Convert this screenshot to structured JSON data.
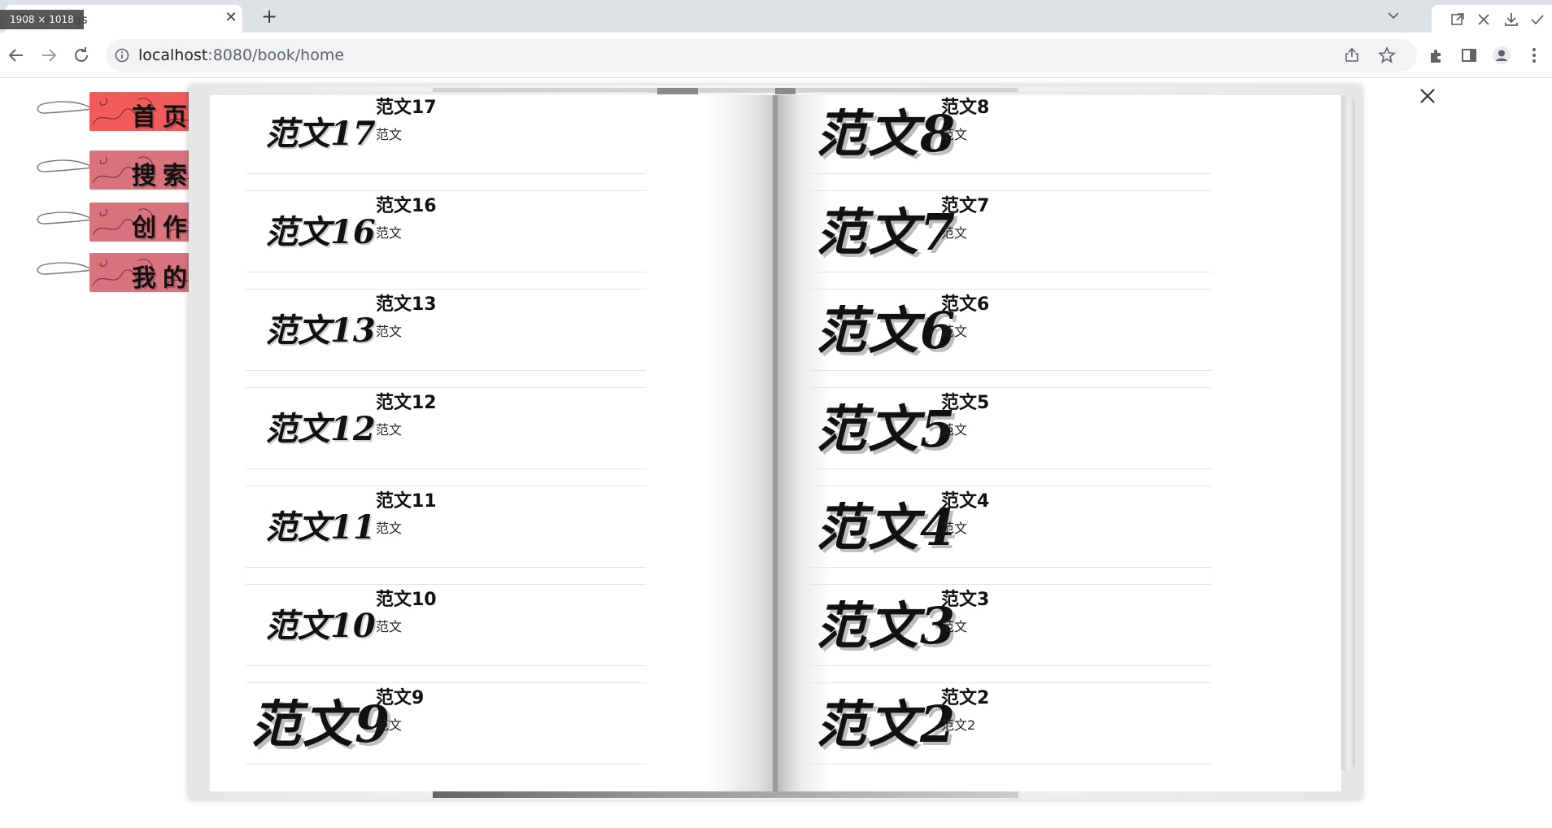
{
  "browser": {
    "tab_title": "ve-blogs",
    "dim_badge": "1908 × 1018",
    "url_host": "localhost",
    "url_rest": ":8080/book/home"
  },
  "side_tags": [
    {
      "label": "首页",
      "active": true
    },
    {
      "label": "搜索",
      "active": false
    },
    {
      "label": "创作",
      "active": false
    },
    {
      "label": "我的",
      "active": false
    }
  ],
  "left_page": [
    {
      "thumb": "范文17",
      "title": "范文17",
      "desc": "范文"
    },
    {
      "thumb": "范文16",
      "title": "范文16",
      "desc": "范文"
    },
    {
      "thumb": "范文13",
      "title": "范文13",
      "desc": "范文"
    },
    {
      "thumb": "范文12",
      "title": "范文12",
      "desc": "范文"
    },
    {
      "thumb": "范文11",
      "title": "范文11",
      "desc": "范文"
    },
    {
      "thumb": "范文10",
      "title": "范文10",
      "desc": "范文"
    },
    {
      "thumb": "范文9",
      "title": "范文9",
      "desc": "范文"
    }
  ],
  "right_page": [
    {
      "thumb": "范文8",
      "title": "范文8",
      "desc": "范文"
    },
    {
      "thumb": "范文7",
      "title": "范文7",
      "desc": "范文"
    },
    {
      "thumb": "范文6",
      "title": "范文6",
      "desc": "范文"
    },
    {
      "thumb": "范文5",
      "title": "范文5",
      "desc": "范文"
    },
    {
      "thumb": "范文4",
      "title": "范文4",
      "desc": "范文"
    },
    {
      "thumb": "范文3",
      "title": "范文3",
      "desc": "范文"
    },
    {
      "thumb": "范文2",
      "title": "范文2",
      "desc": "范文2"
    }
  ],
  "colors": {
    "tag_active": "#f25b5b",
    "tag_inactive": "#d9747f"
  }
}
